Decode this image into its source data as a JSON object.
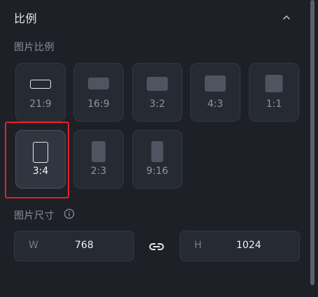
{
  "section": {
    "title": "比例",
    "collapse_icon": "chevron-up-icon"
  },
  "image_ratio": {
    "label": "图片比例",
    "selected": "3:4",
    "options": [
      {
        "label": "21:9",
        "orientation": "landscape"
      },
      {
        "label": "16:9",
        "orientation": "landscape"
      },
      {
        "label": "3:2",
        "orientation": "landscape"
      },
      {
        "label": "4:3",
        "orientation": "landscape"
      },
      {
        "label": "1:1",
        "orientation": "square"
      },
      {
        "label": "3:4",
        "orientation": "portrait"
      },
      {
        "label": "2:3",
        "orientation": "portrait"
      },
      {
        "label": "9:16",
        "orientation": "portrait"
      }
    ]
  },
  "image_size": {
    "label": "图片尺寸",
    "info_icon": "info-circle-icon",
    "width_prefix": "W",
    "width_value": "768",
    "height_prefix": "H",
    "height_value": "1024",
    "link_icon": "link-icon"
  },
  "colors": {
    "background": "#1d2027",
    "card": "#262a32",
    "card_selected": "#30353f",
    "highlight": "#e8202a"
  }
}
